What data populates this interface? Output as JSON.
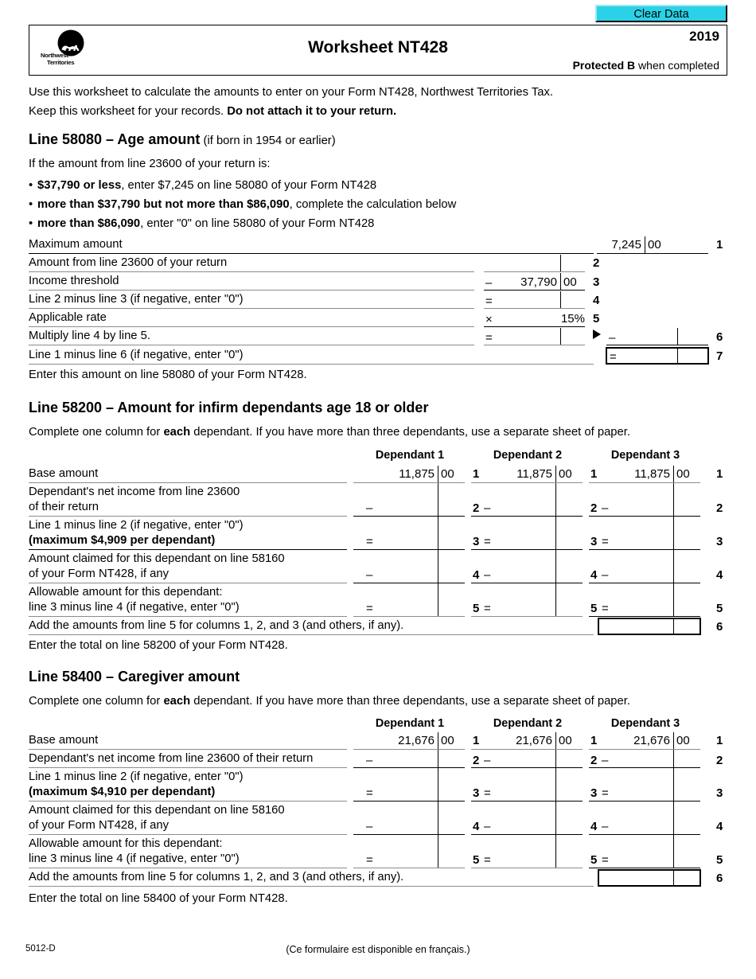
{
  "toolbar": {
    "clear_data_label": "Clear Data"
  },
  "header": {
    "logo_line1": "Northwest",
    "logo_line2": "Territories",
    "title": "Worksheet NT428",
    "year": "2019",
    "protected_strong": "Protected B",
    "protected_rest": " when completed"
  },
  "intro": {
    "line1": "Use this worksheet to calculate the amounts to enter on your Form NT428, Northwest Territories Tax.",
    "line2_a": "Keep this worksheet for your records. ",
    "line2_b": "Do not attach it to your return."
  },
  "section1": {
    "heading_strong": "Line 58080 – Age amount",
    "heading_norm": " (if born in 1954 or earlier)",
    "intro": "If the amount from line 23600 of your return is:",
    "bullets": [
      {
        "strong": "$37,790 or less",
        "rest": ", enter $7,245 on line 58080 of your Form NT428"
      },
      {
        "strong": "more than $37,790 but not more than $86,090",
        "rest": ", complete the calculation below"
      },
      {
        "strong": "more than $86,090",
        "rest": ", enter \"0\" on line 58080 of your Form NT428"
      }
    ],
    "rows": [
      {
        "label": "Maximum amount",
        "no": "1"
      },
      {
        "label": "Amount from line 23600 of your return",
        "no": "2"
      },
      {
        "label": "Income threshold",
        "no": "3"
      },
      {
        "label": "Line 2 minus line 3 (if negative, enter \"0\")",
        "no": "4"
      },
      {
        "label": "Applicable rate",
        "no": "5"
      },
      {
        "label": "Multiply line 4 by line 5.",
        "no": "6"
      },
      {
        "label": "Line 1 minus line 6 (if negative, enter \"0\")",
        "no": "7"
      }
    ],
    "max_amount": "7,245",
    "max_amount_cents": "00",
    "threshold": "37,790",
    "threshold_cents": "00",
    "rate": "15%",
    "op_minus": "–",
    "op_equals": "=",
    "op_times": "×",
    "footer": "Enter this amount on line 58080 of your Form NT428."
  },
  "section2": {
    "heading": "Line 58200 – Amount for infirm dependants age 18 or older",
    "intro_a": "Complete one column for ",
    "intro_b": "each",
    "intro_c": " dependant. If you have more than three dependants, use a separate sheet of paper.",
    "col_headers": [
      "Dependant 1",
      "Dependant 2",
      "Dependant 3"
    ],
    "rows": [
      {
        "label1": "Base amount",
        "label2": "",
        "no": "1",
        "op": ""
      },
      {
        "label1": "Dependant's net income from line 23600",
        "label2": "of their return",
        "no": "2",
        "op": "–"
      },
      {
        "label1": "Line 1 minus line 2 (if negative, enter \"0\")",
        "label2_bold": "(maximum $4,909 per dependant)",
        "no": "3",
        "op": "="
      },
      {
        "label1": "Amount claimed for this dependant on line 58160",
        "label2": "of your Form NT428, if any",
        "no": "4",
        "op": "–"
      },
      {
        "label1": "Allowable amount for this dependant:",
        "label2": "line 3 minus line 4 (if negative, enter \"0\")",
        "no": "5",
        "op": "="
      }
    ],
    "base_amount": "11,875",
    "base_amount_cents": "00",
    "total_label": "Add the amounts from line 5 for columns 1, 2, and 3 (and others, if any).",
    "total_no": "6",
    "footer": "Enter the total on line 58200 of your Form NT428."
  },
  "section3": {
    "heading": "Line 58400 – Caregiver amount",
    "intro_a": "Complete one column for ",
    "intro_b": "each",
    "intro_c": " dependant. If you have more than three dependants, use a separate sheet of paper.",
    "col_headers": [
      "Dependant 1",
      "Dependant 2",
      "Dependant 3"
    ],
    "rows": [
      {
        "label1": "Base amount",
        "label2": "",
        "no": "1",
        "op": ""
      },
      {
        "label1": "Dependant's net income from line 23600 of their return",
        "label2": "",
        "no": "2",
        "op": "–"
      },
      {
        "label1": "Line 1 minus line 2 (if negative, enter \"0\")",
        "label2_bold": "(maximum $4,910 per dependant)",
        "no": "3",
        "op": "="
      },
      {
        "label1": "Amount claimed for this dependant on line 58160",
        "label2": "of your Form NT428, if any",
        "no": "4",
        "op": "–"
      },
      {
        "label1": "Allowable amount for this dependant:",
        "label2": "line 3 minus line 4 (if negative, enter \"0\")",
        "no": "5",
        "op": "="
      }
    ],
    "base_amount": "21,676",
    "base_amount_cents": "00",
    "total_label": "Add the amounts from line 5 for columns 1, 2, and 3 (and others, if any).",
    "total_no": "6",
    "footer": "Enter the total on line 58400 of your Form NT428."
  },
  "footer": {
    "form_code": "5012-D",
    "french_note": "(Ce formulaire est disponible en français.)"
  },
  "colors": {
    "clear_data_bg": "#2ad2e8",
    "rule_grey": "#8c8c8c",
    "rule_black": "#000000"
  }
}
